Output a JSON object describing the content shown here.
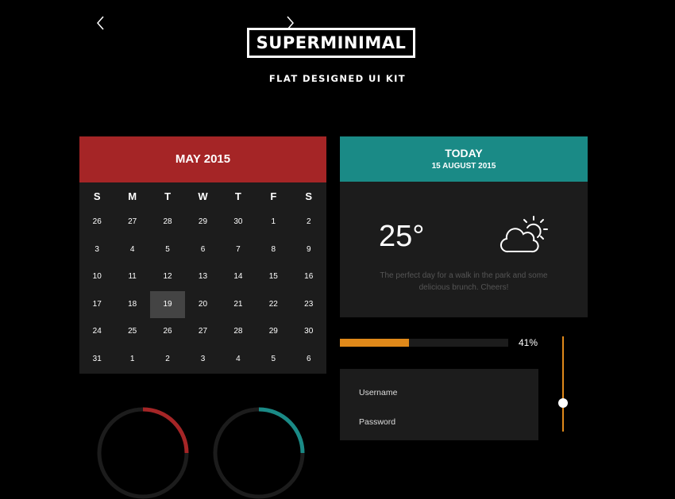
{
  "header": {
    "brand": "SUPERMINIMAL",
    "subtitle": "FLAT DESIGNED UI KIT"
  },
  "calendar": {
    "month_label": "MAY 2015",
    "weekdays": [
      "S",
      "M",
      "T",
      "W",
      "T",
      "F",
      "S"
    ],
    "weeks": [
      [
        "26",
        "27",
        "28",
        "29",
        "30",
        "1",
        "2"
      ],
      [
        "3",
        "4",
        "5",
        "6",
        "7",
        "8",
        "9"
      ],
      [
        "10",
        "11",
        "12",
        "13",
        "14",
        "15",
        "16"
      ],
      [
        "17",
        "18",
        "19",
        "20",
        "21",
        "22",
        "23"
      ],
      [
        "24",
        "25",
        "26",
        "27",
        "28",
        "29",
        "30"
      ],
      [
        "31",
        "1",
        "2",
        "3",
        "4",
        "5",
        "6"
      ]
    ],
    "selected_day": "19",
    "colors": {
      "header": "#a52526",
      "body": "#1c1c1c",
      "selected": "#444444"
    }
  },
  "weather": {
    "title": "TODAY",
    "date": "15 AUGUST 2015",
    "temperature": "25°",
    "icon": "partly-cloudy-icon",
    "description": "The perfect day for a walk in the park and some delicious brunch. Cheers!",
    "colors": {
      "header": "#1a8a86"
    }
  },
  "progress": {
    "value": 0.41,
    "label": "41%",
    "color": "#e0891a"
  },
  "vertical_slider": {
    "value": 0.35,
    "color": "#e0891a"
  },
  "login": {
    "username_label": "Username",
    "password_label": "Password"
  },
  "rings": [
    {
      "name": "red-ring",
      "color": "#a52526"
    },
    {
      "name": "teal-ring",
      "color": "#1a8a86"
    }
  ]
}
